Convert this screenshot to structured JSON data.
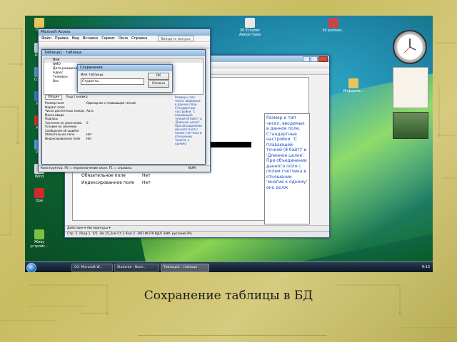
{
  "slide": {
    "caption": "Сохранение таблицы в БД"
  },
  "desktop": {
    "icons_left": [
      "Пол",
      "Корз",
      "Comp",
      "Net",
      "Ado",
      "Win",
      "Wind",
      "Ope",
      "Живу устройс..."
    ],
    "icons_top": [
      "30 Ecoader Айкой Тайи",
      "3d preload..."
    ],
    "icon_folder": "Информа..."
  },
  "taskbar": {
    "buttons": [
      "CO. Microsoft W...",
      "Studente - Bonn..",
      "Таблица1 : таблица"
    ],
    "clock": "9:13"
  },
  "access_window": {
    "title": "Microsoft Access",
    "menu": [
      "Файл",
      "Правка",
      "Вид",
      "Вставка",
      "Сервис",
      "Окно",
      "Справка"
    ],
    "help_placeholder": "Введите вопрос",
    "table_window_title": "Таблица1 : таблица",
    "field_header": "Имя",
    "fields": [
      "ФИО",
      "Дата рождения",
      "Адрес",
      "Телефон",
      "Вес"
    ],
    "tabs": [
      "Общие",
      "Подстановка"
    ],
    "properties": [
      {
        "name": "Размер поля",
        "value": "Одинарное с плавающей точкой"
      },
      {
        "name": "Формат поля",
        "value": ""
      },
      {
        "name": "Число десятичных знаков",
        "value": "Авто"
      },
      {
        "name": "Маска ввода",
        "value": ""
      },
      {
        "name": "Подпись",
        "value": ""
      },
      {
        "name": "Значение по умолчанию",
        "value": "0"
      },
      {
        "name": "Условие на значение",
        "value": ""
      },
      {
        "name": "Сообщение об ошибке",
        "value": ""
      },
      {
        "name": "Обязательное поле",
        "value": "Нет"
      },
      {
        "name": "Индексированное поле",
        "value": "Нет"
      }
    ],
    "side_help": "Размер и тип чисел, вводимых в данное поле. Стандартные настройки: 'С плавающей точкой (8 байт)' и 'Длинное целое'. При объединении данного поля с полем счетчика в отношении 'многие к одному'",
    "status": "Конструктор. F6 = переключение окон. F1 = справка.",
    "status_right": "NUM"
  },
  "save_dialog": {
    "title": "Сохранение",
    "label": "Имя таблицы:",
    "value": "Студенты",
    "ok": "ОК",
    "cancel": "Отмена"
  },
  "word_window": {
    "doc_rows": [
      {
        "name": "Обязательное поле",
        "value": "Нет"
      },
      {
        "name": "Индексированное поле",
        "value": "Нет"
      }
    ],
    "right_help": "Размер и тип чисел, вводимых в данное поле. Стандартные настройки: 'С плавающей точкой (8 байт)' и 'Длинное целое'. При объединении данного поля с полем счетчика в отношении 'многие к одному' оно долж",
    "drawing_bar": "Действия ▾  Автофигуры ▾",
    "status": [
      "Стр. 5",
      "Разд 1",
      "5/5",
      "На 15,3см",
      "Ст 2",
      "Кол 2",
      "ЗАП",
      "ИСПР",
      "ВДЛ",
      "ЗАМ",
      "русский (Ро"
    ]
  },
  "colors": {
    "help_text": "#1a4cc0",
    "titlebar": "#8fb4d8",
    "slide_bg": "#d4c87a"
  }
}
